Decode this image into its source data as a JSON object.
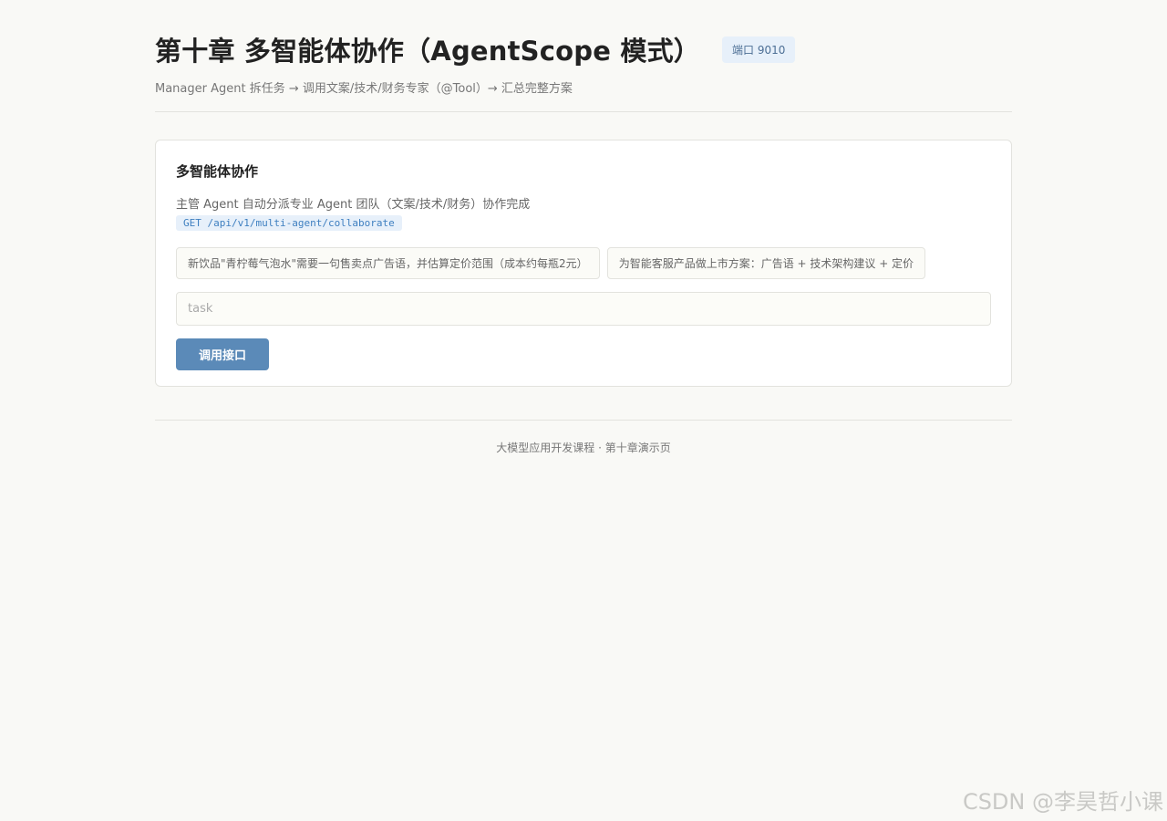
{
  "header": {
    "title": "第十章 多智能体协作（AgentScope 模式）",
    "port_badge": "端口 9010",
    "subtitle": "Manager Agent 拆任务 → 调用文案/技术/财务专家（@Tool）→ 汇总完整方案"
  },
  "card": {
    "title": "多智能体协作",
    "description": "主管 Agent 自动分派专业 Agent 团队（文案/技术/财务）协作完成",
    "endpoint": "GET /api/v1/multi-agent/collaborate",
    "examples": [
      "新饮品\"青柠莓气泡水\"需要一句售卖点广告语，并估算定价范围（成本约每瓶2元）",
      "为智能客服产品做上市方案：广告语 + 技术架构建议 + 定价"
    ],
    "input": {
      "placeholder": "task",
      "value": ""
    },
    "button_label": "调用接口"
  },
  "footer": {
    "text": "大模型应用开发课程 · 第十章演示页"
  },
  "watermark": "CSDN @李昊哲小课"
}
